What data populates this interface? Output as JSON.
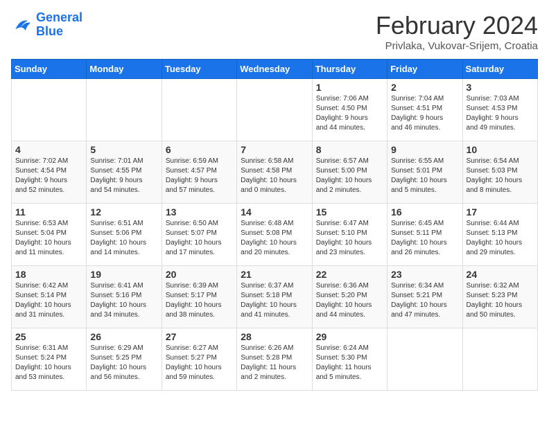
{
  "header": {
    "logo_line1": "General",
    "logo_line2": "Blue",
    "title": "February 2024",
    "subtitle": "Privlaka, Vukovar-Srijem, Croatia"
  },
  "weekdays": [
    "Sunday",
    "Monday",
    "Tuesday",
    "Wednesday",
    "Thursday",
    "Friday",
    "Saturday"
  ],
  "weeks": [
    [
      {
        "day": "",
        "info": ""
      },
      {
        "day": "",
        "info": ""
      },
      {
        "day": "",
        "info": ""
      },
      {
        "day": "",
        "info": ""
      },
      {
        "day": "1",
        "info": "Sunrise: 7:06 AM\nSunset: 4:50 PM\nDaylight: 9 hours\nand 44 minutes."
      },
      {
        "day": "2",
        "info": "Sunrise: 7:04 AM\nSunset: 4:51 PM\nDaylight: 9 hours\nand 46 minutes."
      },
      {
        "day": "3",
        "info": "Sunrise: 7:03 AM\nSunset: 4:53 PM\nDaylight: 9 hours\nand 49 minutes."
      }
    ],
    [
      {
        "day": "4",
        "info": "Sunrise: 7:02 AM\nSunset: 4:54 PM\nDaylight: 9 hours\nand 52 minutes."
      },
      {
        "day": "5",
        "info": "Sunrise: 7:01 AM\nSunset: 4:55 PM\nDaylight: 9 hours\nand 54 minutes."
      },
      {
        "day": "6",
        "info": "Sunrise: 6:59 AM\nSunset: 4:57 PM\nDaylight: 9 hours\nand 57 minutes."
      },
      {
        "day": "7",
        "info": "Sunrise: 6:58 AM\nSunset: 4:58 PM\nDaylight: 10 hours\nand 0 minutes."
      },
      {
        "day": "8",
        "info": "Sunrise: 6:57 AM\nSunset: 5:00 PM\nDaylight: 10 hours\nand 2 minutes."
      },
      {
        "day": "9",
        "info": "Sunrise: 6:55 AM\nSunset: 5:01 PM\nDaylight: 10 hours\nand 5 minutes."
      },
      {
        "day": "10",
        "info": "Sunrise: 6:54 AM\nSunset: 5:03 PM\nDaylight: 10 hours\nand 8 minutes."
      }
    ],
    [
      {
        "day": "11",
        "info": "Sunrise: 6:53 AM\nSunset: 5:04 PM\nDaylight: 10 hours\nand 11 minutes."
      },
      {
        "day": "12",
        "info": "Sunrise: 6:51 AM\nSunset: 5:06 PM\nDaylight: 10 hours\nand 14 minutes."
      },
      {
        "day": "13",
        "info": "Sunrise: 6:50 AM\nSunset: 5:07 PM\nDaylight: 10 hours\nand 17 minutes."
      },
      {
        "day": "14",
        "info": "Sunrise: 6:48 AM\nSunset: 5:08 PM\nDaylight: 10 hours\nand 20 minutes."
      },
      {
        "day": "15",
        "info": "Sunrise: 6:47 AM\nSunset: 5:10 PM\nDaylight: 10 hours\nand 23 minutes."
      },
      {
        "day": "16",
        "info": "Sunrise: 6:45 AM\nSunset: 5:11 PM\nDaylight: 10 hours\nand 26 minutes."
      },
      {
        "day": "17",
        "info": "Sunrise: 6:44 AM\nSunset: 5:13 PM\nDaylight: 10 hours\nand 29 minutes."
      }
    ],
    [
      {
        "day": "18",
        "info": "Sunrise: 6:42 AM\nSunset: 5:14 PM\nDaylight: 10 hours\nand 31 minutes."
      },
      {
        "day": "19",
        "info": "Sunrise: 6:41 AM\nSunset: 5:16 PM\nDaylight: 10 hours\nand 34 minutes."
      },
      {
        "day": "20",
        "info": "Sunrise: 6:39 AM\nSunset: 5:17 PM\nDaylight: 10 hours\nand 38 minutes."
      },
      {
        "day": "21",
        "info": "Sunrise: 6:37 AM\nSunset: 5:18 PM\nDaylight: 10 hours\nand 41 minutes."
      },
      {
        "day": "22",
        "info": "Sunrise: 6:36 AM\nSunset: 5:20 PM\nDaylight: 10 hours\nand 44 minutes."
      },
      {
        "day": "23",
        "info": "Sunrise: 6:34 AM\nSunset: 5:21 PM\nDaylight: 10 hours\nand 47 minutes."
      },
      {
        "day": "24",
        "info": "Sunrise: 6:32 AM\nSunset: 5:23 PM\nDaylight: 10 hours\nand 50 minutes."
      }
    ],
    [
      {
        "day": "25",
        "info": "Sunrise: 6:31 AM\nSunset: 5:24 PM\nDaylight: 10 hours\nand 53 minutes."
      },
      {
        "day": "26",
        "info": "Sunrise: 6:29 AM\nSunset: 5:25 PM\nDaylight: 10 hours\nand 56 minutes."
      },
      {
        "day": "27",
        "info": "Sunrise: 6:27 AM\nSunset: 5:27 PM\nDaylight: 10 hours\nand 59 minutes."
      },
      {
        "day": "28",
        "info": "Sunrise: 6:26 AM\nSunset: 5:28 PM\nDaylight: 11 hours\nand 2 minutes."
      },
      {
        "day": "29",
        "info": "Sunrise: 6:24 AM\nSunset: 5:30 PM\nDaylight: 11 hours\nand 5 minutes."
      },
      {
        "day": "",
        "info": ""
      },
      {
        "day": "",
        "info": ""
      }
    ]
  ]
}
